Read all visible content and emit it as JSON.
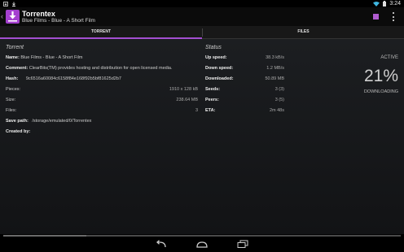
{
  "status_bar": {
    "time": "3:24",
    "left_icons": [
      "app-notification-icon",
      "download-icon"
    ],
    "right_icons": [
      "wifi-icon",
      "battery-icon"
    ]
  },
  "action_bar": {
    "title": "Torrentex",
    "subtitle": "Blue Films - Blue - A Short Film"
  },
  "tabs": [
    {
      "label": "TORRENT",
      "active": true
    },
    {
      "label": "FILES",
      "active": false
    }
  ],
  "torrent": {
    "heading": "Torrent",
    "name_label": "Name:",
    "name": "Blue Films - Blue - A Short Film",
    "comment_label": "Comment:",
    "comment": "ClearBits(TM) provides hosting and distribution for open licensed media.",
    "hash_label": "Hash:",
    "hash": "9c6516a60084c6158f84e168f92b5bf81625d2b7",
    "pieces_label": "Pieces:",
    "pieces": "1910 x 128 kB",
    "size_label": "Size:",
    "size": "238.64 MB",
    "files_label": "Files:",
    "files": "3",
    "save_path_label": "Save path:",
    "save_path": "/storage/emulated/0/Torrentex",
    "created_by_label": "Created by:",
    "created_by": ""
  },
  "status": {
    "heading": "Status",
    "up_speed_label": "Up speed:",
    "up_speed": "38.3 kB/s",
    "down_speed_label": "Down speed:",
    "down_speed": "1.2 MB/s",
    "downloaded_label": "Downloaded:",
    "downloaded": "50.89 MB",
    "seeds_label": "Seeds:",
    "seeds": "3 (3)",
    "peers_label": "Peers:",
    "peers": "3 (5)",
    "eta_label": "ETA:",
    "eta": "2m 48s",
    "state": "ACTIVE",
    "percent": "21%",
    "phase": "DOWNLOADING"
  },
  "progress": {
    "fraction": 0.21
  },
  "colors": {
    "accent": "#a44fd1",
    "stop": "#b05bd0"
  },
  "nav_bar": {
    "icons": [
      "back-icon",
      "home-icon",
      "recent-apps-icon"
    ]
  }
}
